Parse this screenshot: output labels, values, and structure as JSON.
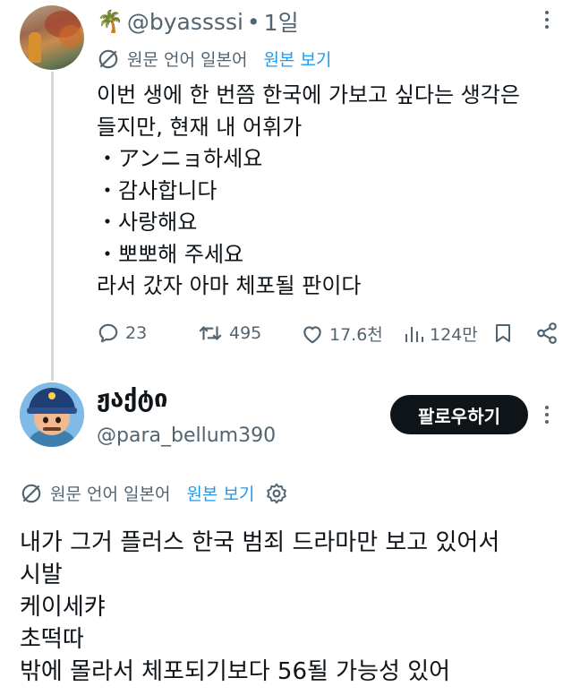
{
  "tweet1": {
    "handle": "@byassssi",
    "time": "1일",
    "translation_note": "원문 언어 일본어",
    "show_original": "원본 보기",
    "lines": [
      "이번 생에 한 번쯤 한국에 가보고 싶다는 생각은",
      "들지만, 현재 내 어휘가",
      "・アンニョ하세요",
      "・감사합니다",
      "・사랑해요",
      "・뽀뽀해 주세요",
      "라서 갔자 아마 체포될 판이다"
    ],
    "stats": {
      "replies": "23",
      "reposts": "495",
      "likes": "17.6천",
      "views": "124만"
    }
  },
  "tweet2": {
    "display_name": "ჟაქტი",
    "handle": "@para_bellum390",
    "follow_label": "팔로우하기",
    "translation_note": "원문 언어 일본어",
    "show_original": "원본 보기",
    "lines": [
      "내가 그거 플러스 한국 범죄 드라마만 보고 있어서",
      "시발",
      "케이세캬",
      "초떡따",
      "밖에 몰라서 체포되기보다 56될 가능성 있어"
    ]
  },
  "colors": {
    "text": "#0f1419",
    "muted": "#536471",
    "link": "#1d9bf0",
    "thread": "#cfd9de",
    "button": "#0f1419"
  }
}
